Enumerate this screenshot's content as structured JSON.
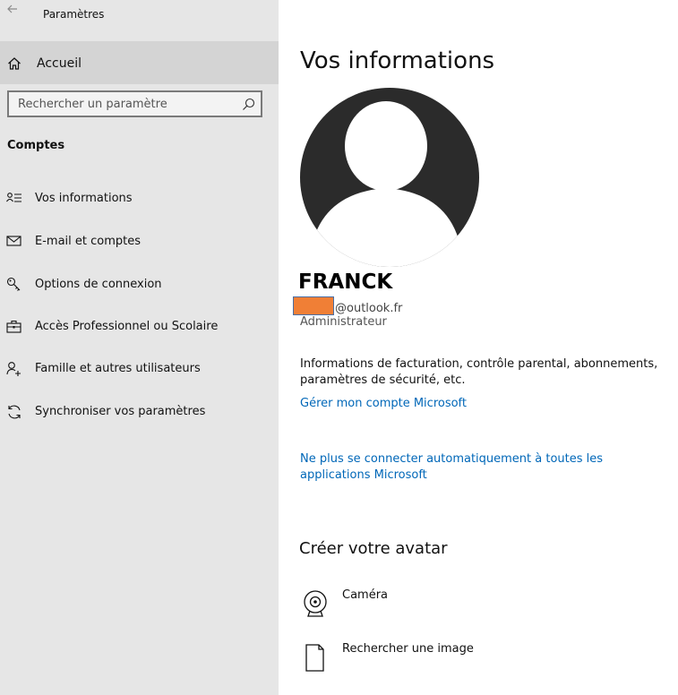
{
  "window": {
    "title": "Paramètres"
  },
  "sidebar": {
    "home_label": "Accueil",
    "search": {
      "placeholder": "Rechercher un paramètre"
    },
    "section_title": "Comptes",
    "items": [
      {
        "label": "Vos informations",
        "icon": "person-info-icon"
      },
      {
        "label": "E-mail et comptes",
        "icon": "mail-icon"
      },
      {
        "label": "Options de connexion",
        "icon": "key-icon"
      },
      {
        "label": "Accès Professionnel ou Scolaire",
        "icon": "briefcase-icon"
      },
      {
        "label": "Famille et autres utilisateurs",
        "icon": "add-person-icon"
      },
      {
        "label": "Synchroniser vos paramètres",
        "icon": "sync-icon"
      }
    ]
  },
  "main": {
    "heading": "Vos informations",
    "user": {
      "name": "FRANCK",
      "email_domain": "@outlook.fr",
      "role": "Administrateur"
    },
    "info_text": "Informations de facturation, contrôle parental, abonnements, paramètres de sécurité, etc.",
    "manage_link": "Gérer mon compte Microsoft",
    "signout_link": "Ne plus se connecter automatiquement à toutes les applications Microsoft",
    "avatar_section": {
      "title": "Créer votre avatar",
      "options": [
        {
          "label": "Caméra",
          "icon": "camera-icon"
        },
        {
          "label": "Rechercher une image",
          "icon": "browse-image-icon"
        }
      ]
    }
  },
  "colors": {
    "accent": "#0067b8",
    "redaction": "#f07f36",
    "sidebar_bg": "#e6e6e6",
    "selected_bg": "#d4d4d4"
  }
}
